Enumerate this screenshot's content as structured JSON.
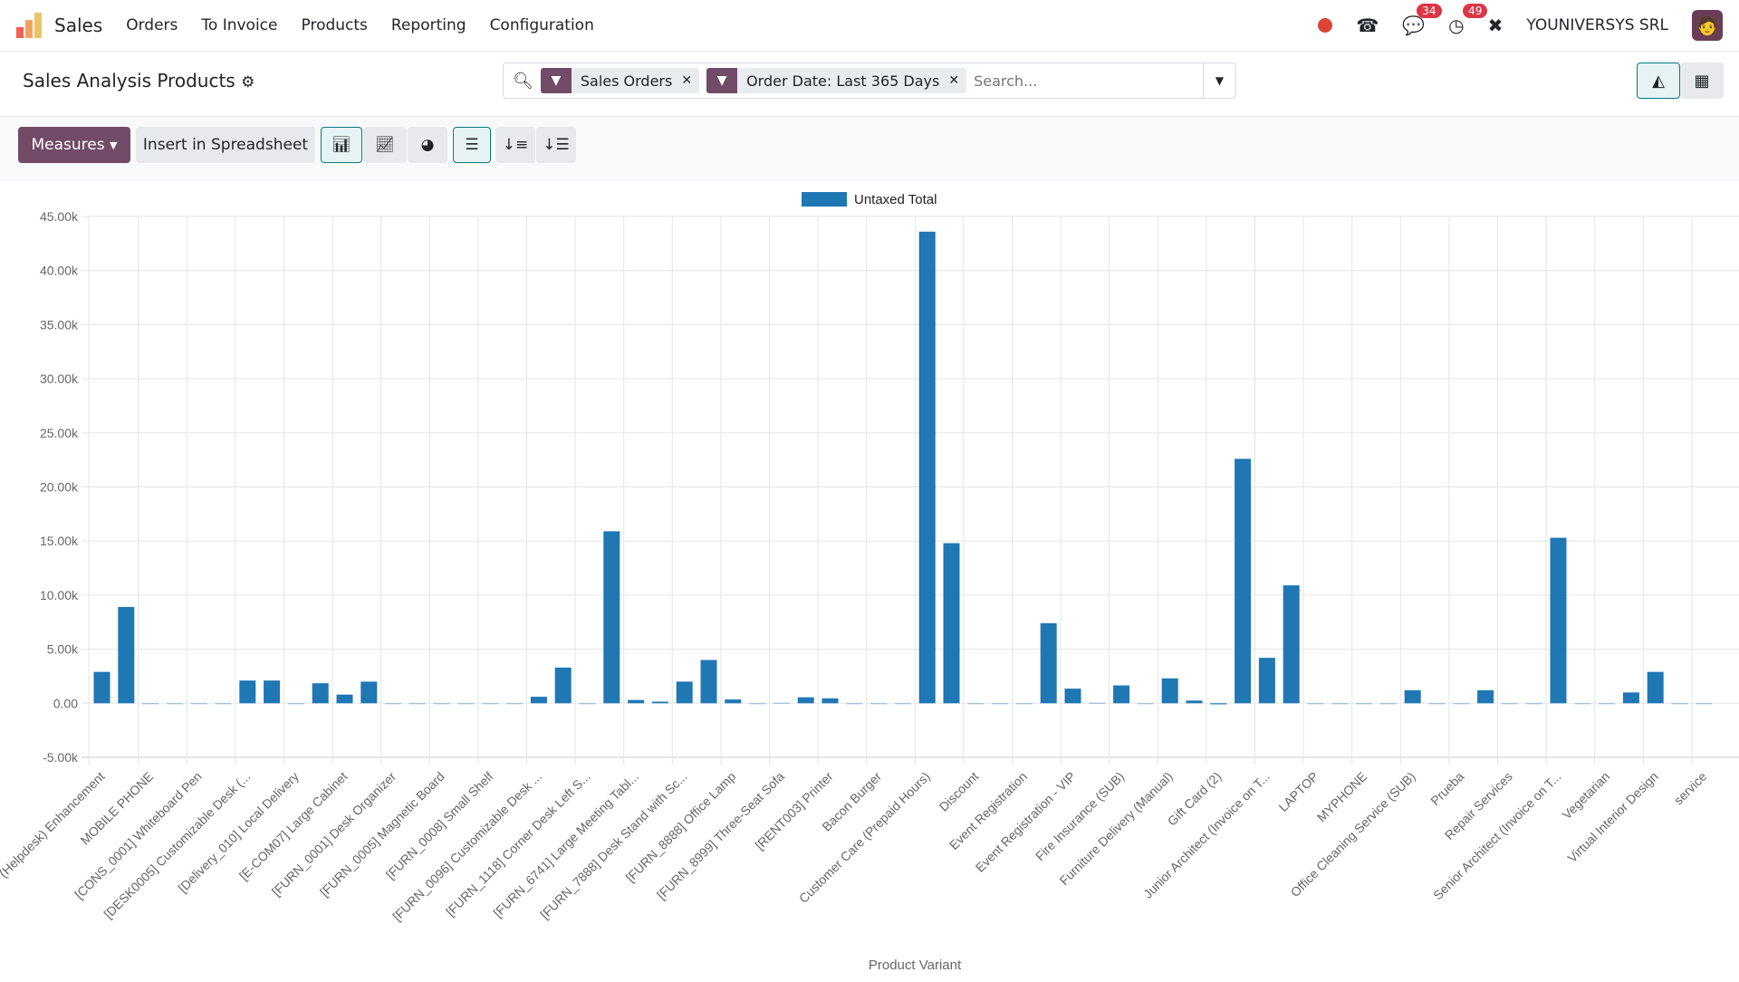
{
  "navbar": {
    "app": "Sales",
    "menus": [
      "Orders",
      "To Invoice",
      "Products",
      "Reporting",
      "Configuration"
    ],
    "company": "YOUNIVERSYS SRL",
    "messages_count": "34",
    "activities_count": "49"
  },
  "control": {
    "title": "Sales Analysis Products",
    "facets": [
      "Sales Orders",
      "Order Date: Last 365 Days"
    ],
    "search_placeholder": "Search...",
    "measures": "Measures",
    "insert": "Insert in Spreadsheet"
  },
  "colors": {
    "bar": "#1f77b4",
    "brand": "#714b67",
    "accent": "#017e84"
  },
  "chart_data": {
    "type": "bar",
    "legend": "Untaxed Total",
    "legend_position": "top",
    "xlabel": "Product Variant",
    "ylabel": "",
    "ylim": [
      -5000,
      45000
    ],
    "yticks": [
      "-5.00k",
      "0.00",
      "5.00k",
      "10.00k",
      "15.00k",
      "20.00k",
      "25.00k",
      "30.00k",
      "35.00k",
      "40.00k",
      "45.00k"
    ],
    "grid": true,
    "labels": [
      "(Helpdesk) Enhancement",
      "MOBILE PHONE",
      "[CONS_0001] Whiteboard Pen",
      "[DESK0005] Customizable Desk (...",
      "[Delivery_010] Local Delivery",
      "[E-COM07] Large Cabinet",
      "[FURN_0001] Desk Organizer",
      "[FURN_0005] Magnetic Board",
      "[FURN_0008] Small Shelf",
      "[FURN_0096] Customizable Desk ...",
      "[FURN_1118] Corner Desk Left S...",
      "[FURN_6741] Large Meeting Tabl...",
      "[FURN_7888] Desk Stand with Sc...",
      "[FURN_8888] Office Lamp",
      "[FURN_8999] Three-Seat Sofa",
      "[RENT003] Printer",
      "Bacon Burger",
      "Customer Care (Prepaid Hours)",
      "Discount",
      "Event Registration",
      "Event Registration - VIP",
      "Fire Insurance (SUB)",
      "Furniture Delivery (Manual)",
      "Gift Card (2)",
      "Junior Architect (Invoice on T...",
      "LAPTOP",
      "MYPHONE",
      "Office Cleaning Service (SUB)",
      "Prueba",
      "Repair Services",
      "Senior Architect (Invoice on T...",
      "Vegetarian",
      "Virtual Interior Design",
      "service"
    ],
    "values": [
      2900,
      8900,
      0,
      0,
      0,
      0,
      2100,
      2100,
      0,
      1850,
      800,
      2000,
      0,
      0,
      0,
      0,
      0,
      0,
      600,
      3300,
      0,
      15900,
      300,
      150,
      2000,
      4000,
      350,
      0,
      50,
      550,
      450,
      0,
      0,
      0,
      43600,
      14800,
      -50,
      0,
      0,
      7400,
      1350,
      50,
      1650,
      0,
      2300,
      250,
      -100,
      22600,
      4200,
      10900,
      0,
      0,
      0,
      0,
      1200,
      0,
      0,
      1200,
      0,
      0,
      15300,
      0,
      0,
      1000,
      2900,
      0,
      0
    ]
  }
}
